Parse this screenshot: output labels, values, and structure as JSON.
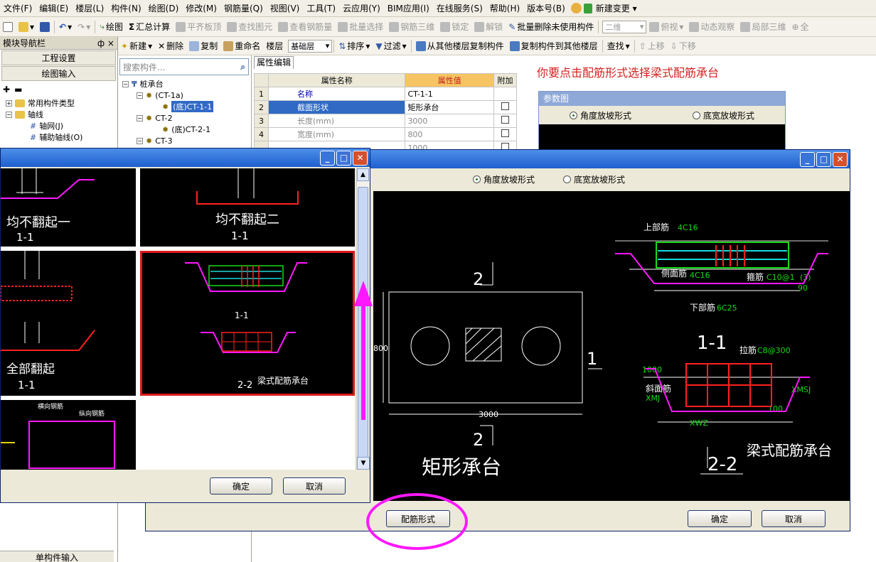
{
  "menu": [
    "文件(F)",
    "编辑(E)",
    "楼层(L)",
    "构件(N)",
    "绘图(D)",
    "修改(M)",
    "钢筋量(Q)",
    "视图(V)",
    "工具(T)",
    "云应用(Y)",
    "BIM应用(I)",
    "在线服务(S)",
    "帮助(H)",
    "版本号(B)",
    "新建变更 ▾"
  ],
  "toolbar1": {
    "draw": "绘图",
    "sum": "汇总计算",
    "flat_top": "平齐板顶",
    "find_elem": "查找图元",
    "view_rebar": "查看钢筋量",
    "batch_select": "批量选择",
    "rebar_3d": "钢筋三维",
    "lock": "锁定",
    "unlock": "解锁",
    "batch_delete": "批量删除未使用构件",
    "view_mode": "二维",
    "plan_view": "俯视",
    "dynamic": "动态观察",
    "local_3d": "局部三维",
    "all": "全"
  },
  "toolbar2": {
    "new": "新建",
    "delete": "删除",
    "copy": "复制",
    "rename": "重命名",
    "floor_label": "楼层",
    "floor_value": "基础层",
    "sort": "排序",
    "filter": "过滤",
    "copy_from": "从其他楼层复制构件",
    "copy_to": "复制构件到其他楼层",
    "find": "查找",
    "up": "上移",
    "down": "下移"
  },
  "nav": {
    "title": "模块导航栏",
    "pin": "ф ×",
    "project": "工程设置",
    "draw_input": "绘图输入",
    "common_types": "常用构件类型",
    "axis": "轴线",
    "grid": "轴网(J)",
    "aux": "辅助轴线(O)",
    "single_input": "单构件输入"
  },
  "search": {
    "placeholder": "搜索构件..."
  },
  "tree": {
    "root": "桩承台",
    "ct1a": "(CT-1a)",
    "ct11": "(底)CT-1-1",
    "ct2": "CT-2",
    "ct21": "(底)CT-2-1",
    "ct3": "CT-3"
  },
  "props": {
    "tab": "属性编辑",
    "headers": [
      "属性名称",
      "属性值",
      "附加"
    ],
    "rows": [
      {
        "no": "1",
        "name": "名称",
        "value": "CT-1-1"
      },
      {
        "no": "2",
        "name": "截面形状",
        "value": "矩形承台"
      },
      {
        "no": "3",
        "name": "长度(mm)",
        "value": "3000"
      },
      {
        "no": "4",
        "name": "宽度(mm)",
        "value": "800"
      },
      {
        "no": "",
        "name": "",
        "value": "1000"
      }
    ]
  },
  "hint": "你要点击配筋形式选择梁式配筋承台",
  "param": {
    "title": "参数图",
    "radio_angle": "角度放坡形式",
    "radio_width": "底宽放坡形式"
  },
  "dlg_select": {
    "ok": "确定",
    "cancel": "取消",
    "labels": {
      "a": "均不翻起一",
      "a_sec": "1-1",
      "b": "均不翻起二",
      "b_sec": "1-1",
      "c": "全部翻起",
      "c_sec": "1-1",
      "d_sec1": "1-1",
      "d_sec2": "2-2",
      "d": "梁式配筋承台",
      "e1": "横向钢筋",
      "e2": "纵向钢筋"
    }
  },
  "dlg_param": {
    "radio_angle": "角度放坡形式",
    "radio_width": "底宽放坡形式",
    "rebar_form": "配筋形式",
    "ok": "确定",
    "cancel": "取消",
    "drawing": {
      "sec2_top": "2",
      "sec2_bot": "2",
      "sec1": "1",
      "dim_w": "800",
      "dim_l": "3000",
      "shape_name": "矩形承台",
      "top_rebar": "上部筋",
      "top_rebar_v": "4C16",
      "side_rebar": "侧面筋",
      "side_rebar_v": "4C16",
      "stirrup": "箍筋",
      "stirrup_v": "C10@1",
      "stirrup_v2": "(3)",
      "bottom_rebar": "下部筋",
      "bottom_rebar_v": "6C25",
      "angle": "90",
      "sec11": "1-1",
      "tie": "拉筋",
      "tie_v": "C8@300",
      "slope": "斜面筋",
      "dim_h": "1000",
      "xmj": "XMJ",
      "xwz": "XWZ",
      "xmsj": "XMSJ",
      "dim_100": "100",
      "sec22": "2-2",
      "beam_type": "梁式配筋承台"
    }
  },
  "colors": {
    "accent_magenta": "#ff18ff",
    "rebar_red": "#ff2020",
    "rebar_green": "#19d919",
    "rebar_cyan": "#19d9d9",
    "titlebar_blue": "#2a66d6"
  }
}
